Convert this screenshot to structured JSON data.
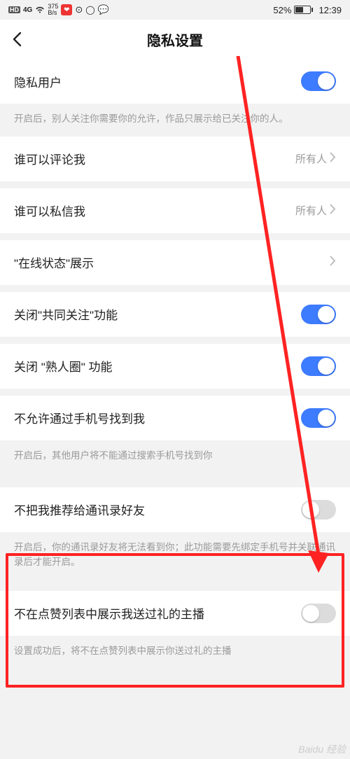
{
  "status": {
    "hd": "HD",
    "net": "4G",
    "speed_top": "375",
    "speed_bot": "B/s",
    "battery_pct": "52%",
    "time": "12:39"
  },
  "header": {
    "title": "隐私设置"
  },
  "rows": {
    "private_user": {
      "label": "隐私用户"
    },
    "private_user_hint": "开启后，别人关注你需要你的允许，作品只展示给已关注你的人。",
    "comment": {
      "label": "谁可以评论我",
      "value": "所有人"
    },
    "dm": {
      "label": "谁可以私信我",
      "value": "所有人"
    },
    "online": {
      "label": "\"在线状态\"展示"
    },
    "close_mutual": {
      "label": "关闭\"共同关注\"功能"
    },
    "close_acq": {
      "label": "关闭 \"熟人圈\" 功能"
    },
    "phone_find": {
      "label": "不允许通过手机号找到我"
    },
    "phone_find_hint": "开启后，其他用户将不能通过搜索手机号找到你",
    "no_recommend": {
      "label": "不把我推荐给通讯录好友"
    },
    "no_recommend_hint": "开启后，你的通讯录好友将无法看到你；此功能需要先绑定手机号并关联通讯录后才能开启。",
    "no_gift": {
      "label": "不在点赞列表中展示我送过礼的主播"
    },
    "no_gift_hint": "设置成功后，将不在点赞列表中展示你送过礼的主播"
  },
  "watermark": "Baidu 经验"
}
